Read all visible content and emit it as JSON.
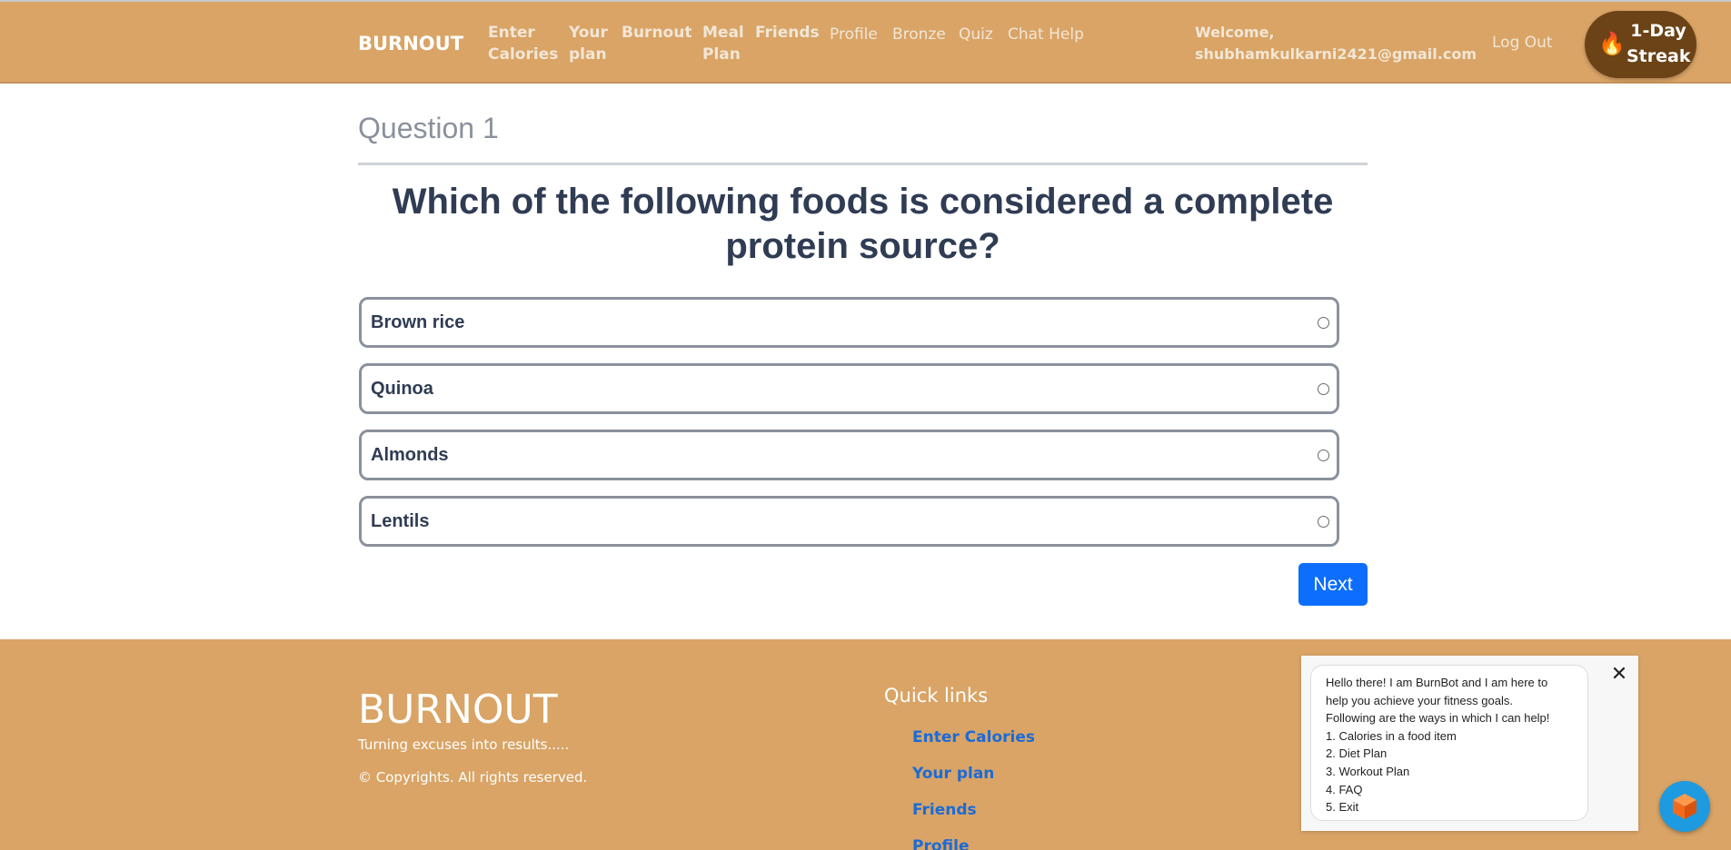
{
  "header": {
    "brand": "BURNOUT",
    "nav": [
      {
        "line1": "Enter",
        "line2": "Calories"
      },
      {
        "line1": "Your",
        "line2": "plan"
      },
      {
        "line1": "Burnout",
        "line2": ""
      },
      {
        "line1": "Meal",
        "line2": "Plan"
      },
      {
        "line1": "Friends",
        "line2": ""
      },
      {
        "line1": "Profile",
        "line2": ""
      },
      {
        "line1": "Bronze",
        "line2": ""
      },
      {
        "line1": "Quiz",
        "line2": ""
      },
      {
        "line1": "Chat Help",
        "line2": ""
      }
    ],
    "welcome_line1": "Welcome,",
    "welcome_line2": "shubhamkulkarni2421@gmail.com",
    "logout": "Log Out",
    "streak_icon": "flame-icon",
    "streak_line1": "1-Day",
    "streak_line2": "Streak",
    "streak_flame": "🔥"
  },
  "quiz": {
    "question_number": "Question 1",
    "question_text": "Which of the following foods is considered a complete protein source?",
    "options": [
      "Brown rice",
      "Quinoa",
      "Almonds",
      "Lentils"
    ],
    "next_label": "Next"
  },
  "footer": {
    "brand": "BURNOUT",
    "tagline": "Turning excuses into results.....",
    "copyright": "© Copyrights. All rights reserved.",
    "quick_links_title": "Quick links",
    "quick_links": [
      "Enter Calories",
      "Your plan",
      "Friends",
      "Profile"
    ]
  },
  "chatbot": {
    "lines": [
      "Hello there! I am BurnBot and I am here to",
      "help you achieve your fitness goals.",
      "Following are the ways in which I can help!",
      "1. Calories in a food item",
      "2. Diet Plan",
      "3. Workout Plan",
      "4. FAQ",
      "5. Exit"
    ],
    "close_glyph": "✕",
    "launcher_icon": "cube-icon"
  },
  "colors": {
    "header_bg": "#d9a466",
    "streak_bg": "#6b4316",
    "primary_button": "#0d6efd",
    "text_dark": "#2f3c53"
  }
}
